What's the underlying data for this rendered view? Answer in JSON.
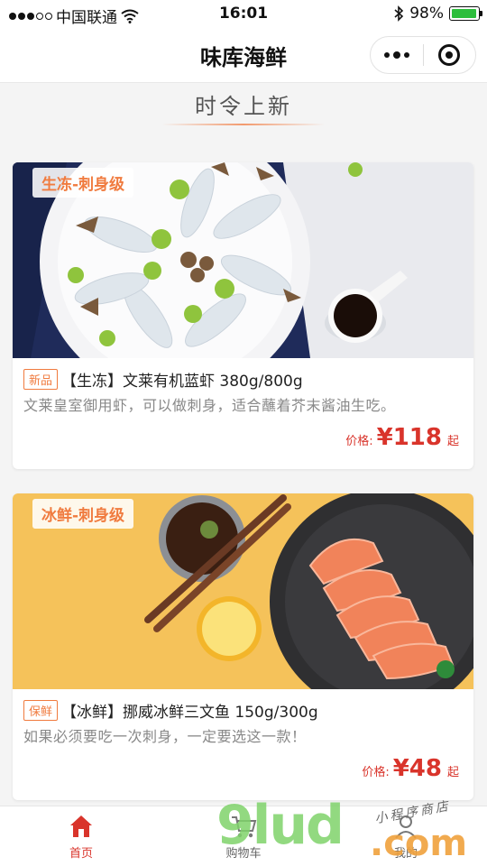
{
  "status_bar": {
    "carrier": "中国联通",
    "time": "16:01",
    "battery": "98%",
    "battery_level": 0.98
  },
  "nav": {
    "title": "味库海鲜"
  },
  "section": {
    "title": "时令上新"
  },
  "products": [
    {
      "tag": "生冻-刺身级",
      "badge": "新品",
      "title": "【生冻】文莱有机蓝虾 380g/800g",
      "desc": "文莱皇室御用虾，可以做刺身，适合蘸着芥末酱油生吃。",
      "price_label": "价格:",
      "price": "¥118",
      "price_suffix": "起"
    },
    {
      "tag": "冰鲜-刺身级",
      "badge": "保鲜",
      "title": "【冰鲜】挪威冰鲜三文鱼 150g/300g",
      "desc": "如果必须要吃一次刺身，一定要选这一款！",
      "price_label": "价格:",
      "price": "¥48",
      "price_suffix": "起"
    }
  ],
  "tab_bar": {
    "items": [
      {
        "label": "首页",
        "icon": "home-icon"
      },
      {
        "label": "购物车",
        "icon": "cart-icon"
      },
      {
        "label": "我的",
        "icon": "user-icon"
      }
    ]
  },
  "watermark": {
    "main": "9lud",
    "sub": ".com",
    "script": "小程序商店"
  },
  "colors": {
    "accent": "#f07b3f",
    "price": "#d9342b",
    "active_tab": "#d9342b"
  }
}
